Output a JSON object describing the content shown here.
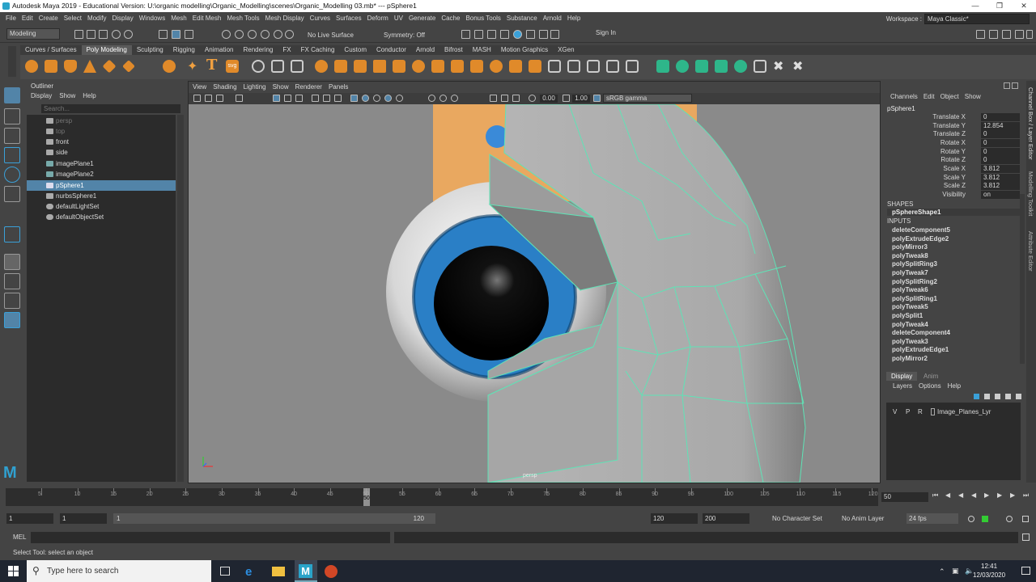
{
  "title": "Autodesk Maya 2019 - Educational Version: U:\\organic modelling\\Organic_Modelling\\scenes\\Organic_Modelling 03.mb*   ---   pSphere1",
  "menu": [
    "File",
    "Edit",
    "Create",
    "Select",
    "Modify",
    "Display",
    "Windows",
    "Mesh",
    "Edit Mesh",
    "Mesh Tools",
    "Mesh Display",
    "Curves",
    "Surfaces",
    "Deform",
    "UV",
    "Generate",
    "Cache",
    "Bonus Tools",
    "Substance",
    "Arnold",
    "Help"
  ],
  "workspace": {
    "label": "Workspace :",
    "value": "Maya Classic*"
  },
  "status": {
    "mode": "Modeling",
    "live_surface": "No Live Surface",
    "symmetry": "Symmetry: Off",
    "sign_in": "Sign In"
  },
  "shelf_tabs": [
    "Curves / Surfaces",
    "Poly Modeling",
    "Sculpting",
    "Rigging",
    "Animation",
    "Rendering",
    "FX",
    "FX Caching",
    "Custom",
    "Conductor",
    "Arnold",
    "Bifrost",
    "MASH",
    "Motion Graphics",
    "XGen"
  ],
  "outliner": {
    "title": "Outliner",
    "menu": [
      "Display",
      "Show",
      "Help"
    ],
    "search_placeholder": "Search...",
    "items": [
      {
        "label": "persp",
        "state": "dim"
      },
      {
        "label": "top",
        "state": "dim"
      },
      {
        "label": "front",
        "state": "normal"
      },
      {
        "label": "side",
        "state": "normal"
      },
      {
        "label": "imagePlane1",
        "state": "normal"
      },
      {
        "label": "imagePlane2",
        "state": "normal"
      },
      {
        "label": "pSphere1",
        "state": "selected"
      },
      {
        "label": "nurbsSphere1",
        "state": "normal"
      },
      {
        "label": "defaultLightSet",
        "state": "normal"
      },
      {
        "label": "defaultObjectSet",
        "state": "normal"
      }
    ]
  },
  "viewport": {
    "menu": [
      "View",
      "Shading",
      "Lighting",
      "Show",
      "Renderer",
      "Panels"
    ],
    "exposure": "0.00",
    "gamma": "1.00",
    "color_space": "sRGB gamma",
    "camera_label": "persp"
  },
  "channel_box": {
    "menu": [
      "Channels",
      "Edit",
      "Object",
      "Show"
    ],
    "object": "pSphere1",
    "channels": [
      {
        "name": "Translate X",
        "value": "0"
      },
      {
        "name": "Translate Y",
        "value": "12.854"
      },
      {
        "name": "Translate Z",
        "value": "0"
      },
      {
        "name": "Rotate X",
        "value": "0"
      },
      {
        "name": "Rotate Y",
        "value": "0"
      },
      {
        "name": "Rotate Z",
        "value": "0"
      },
      {
        "name": "Scale X",
        "value": "3.812"
      },
      {
        "name": "Scale Y",
        "value": "3.812"
      },
      {
        "name": "Scale Z",
        "value": "3.812"
      },
      {
        "name": "Visibility",
        "value": "on"
      }
    ],
    "shapes_header": "SHAPES",
    "shape": "pSphereShape1",
    "inputs_header": "INPUTS",
    "inputs": [
      "deleteComponent5",
      "polyExtrudeEdge2",
      "polyMirror3",
      "polyTweak8",
      "polySplitRing3",
      "polyTweak7",
      "polySplitRing2",
      "polyTweak6",
      "polySplitRing1",
      "polyTweak5",
      "polySplit1",
      "polyTweak4",
      "deleteComponent4",
      "polyTweak3",
      "polyExtrudeEdge1",
      "polyMirror2"
    ]
  },
  "side_tabs": [
    "Channel Box / Layer Editor",
    "Modelling Toolkit",
    "Attribute Editor"
  ],
  "layer_editor": {
    "tabs": [
      "Display",
      "Anim"
    ],
    "menu": [
      "Layers",
      "Options",
      "Help"
    ],
    "flags": [
      "V",
      "P",
      "R"
    ],
    "layer": "Image_Planes_Lyr"
  },
  "timeline": {
    "ticks": [
      "5",
      "10",
      "15",
      "20",
      "25",
      "30",
      "35",
      "40",
      "45",
      "50",
      "55",
      "60",
      "65",
      "70",
      "75",
      "80",
      "85",
      "90",
      "95",
      "100",
      "105",
      "110",
      "115",
      "120"
    ],
    "current_frame": "50",
    "current_field": "50"
  },
  "range": {
    "start": "1",
    "start2": "1",
    "inner_start": "1",
    "inner_end": "120",
    "end": "120",
    "end2": "200",
    "character_set": "No Character Set",
    "anim_layer": "No Anim Layer",
    "fps": "24 fps"
  },
  "command_line": {
    "label": "MEL"
  },
  "help_line": "Select Tool: select an object",
  "taskbar": {
    "search": "Type here to search",
    "time": "12:41",
    "date": "12/03/2020"
  },
  "colors": {
    "accent": "#5284a8",
    "iris": "#2a7fc6",
    "wire": "#5fe3b6",
    "bg_plate": "#e9a860"
  }
}
